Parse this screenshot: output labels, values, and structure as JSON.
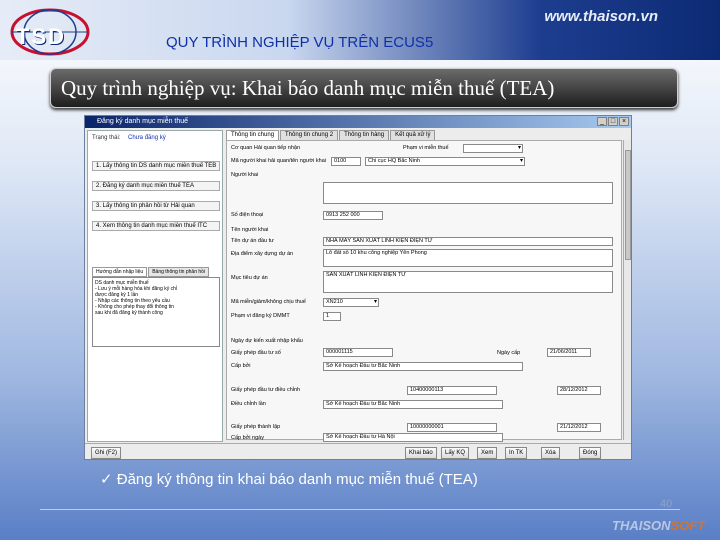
{
  "header": {
    "logo": "TSD",
    "url": "www.thaison.vn",
    "title": "QUY TRÌNH NGHIỆP VỤ TRÊN ECUS5"
  },
  "subtitle": "Quy trình nghiệp vụ: Khai báo danh mục miễn thuế (TEA)",
  "app": {
    "window_title": "Đăng ký danh mục miễn thuế",
    "left_pane": {
      "status_label": "Trạng thái:",
      "status_value": "Chưa đăng ký",
      "steps": [
        "1. Lấy thông tin DS danh mục miễn thuế TEB",
        "2. Đăng ký danh mục miễn thuế TEA",
        "3. Lấy thông tin phản hồi từ Hải quan",
        "4. Xem thông tin danh mục miễn thuế ITC"
      ],
      "tabs": [
        "Hướng dẫn nhập liệu",
        "Bảng thông tin phản hồi"
      ],
      "help_text": [
        "DS danh mục miễn thuế",
        "- Lưu ý mỗi hàng hóa khi đăng ký chỉ",
        "được đăng ký 1 lần",
        "- Nhập các thông tin theo yêu cầu",
        "- Không cho phép thay đổi thông tin",
        "sau khi đã đăng ký thành công"
      ]
    },
    "tabs": [
      "Thông tin chung",
      "Thông tin chung 2",
      "Thông tin hàng",
      "Kết quả xử lý"
    ],
    "form": {
      "fields": [
        {
          "label": "Cơ quan Hải quan tiếp nhận",
          "value": ""
        },
        {
          "label": "Mã người khai hải quan/tên người khai",
          "value": "0100"
        },
        {
          "label": "Người khai",
          "value": ""
        },
        {
          "label": "Địa chỉ",
          "value": "Chi cục HQ Bắc Ninh"
        },
        {
          "label": "Số điện thoại",
          "value": "0913 252 000"
        },
        {
          "label": "Tên người khai",
          "value": ""
        },
        {
          "label": "Tên dự án đầu tư",
          "value": "NHÀ MÁY SẢN XUẤT LINH KIỆN ĐIỆN TỬ"
        },
        {
          "label": "Địa điểm xây dựng dự án",
          "value": "Lô đất số 10 khu công nghiệp Yên Phong"
        },
        {
          "label": "Mục tiêu dự án",
          "value": "SẢN XUẤT LINH KIỆN ĐIỆN TỬ"
        },
        {
          "label": "Mã miễn/giảm/không chịu thuế",
          "value": "XN210"
        },
        {
          "label": "Phạm vi đăng ký DMMT",
          "value": "1"
        },
        {
          "label": "Ngày dự kiến xuất nhập khẩu",
          "value": ""
        },
        {
          "label": "Giấy phép đầu tư số",
          "value": "000001115"
        },
        {
          "label": "Cấp bởi",
          "value": "Sở Kế hoạch Đầu tư Bắc Ninh"
        },
        {
          "label": "Giấy phép đầu tư điều chỉnh",
          "value": "10400000113"
        },
        {
          "label": "Điều chỉnh lần",
          "value": "Sở Kế hoạch Đầu tư Bắc Ninh"
        },
        {
          "label": "Giấy phép thành lập",
          "value": "10000000001"
        },
        {
          "label": "Cấp bởi ngày",
          "value": "Sở Kế hoạch Đầu tư Hà Nội"
        }
      ],
      "dates": [
        "21/06/2011",
        "28/12/2012",
        "21/12/2012"
      ],
      "right_label": "Phạm vi miễn thuế",
      "date_label": "Ngày cấp"
    },
    "bottom_buttons": [
      "Ghi (F2)",
      "Khai báo",
      "Lấy KQ",
      "Xem",
      "In TK",
      "Xóa",
      "Đóng"
    ]
  },
  "caption": "Đăng ký thông tin khai báo danh mục miễn thuế (TEA)",
  "page_number": "40",
  "footer": {
    "brand_main": "THAISON",
    "brand_accent": "SOFT"
  },
  "colors": {
    "accent": "#1030a8",
    "brand_orange": "#d4732a"
  }
}
